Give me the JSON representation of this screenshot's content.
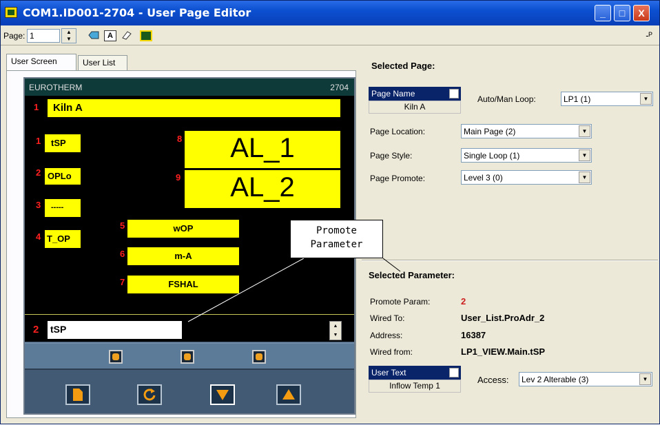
{
  "window": {
    "title": "COM1.ID001-2704 - User Page Editor",
    "min": "_",
    "max": "□",
    "close": "X"
  },
  "toolbar": {
    "page_label": "Page:",
    "page_value": "1",
    "pin": "-ᴾ"
  },
  "tabs": [
    {
      "label": "User Screen"
    },
    {
      "label": "User List"
    }
  ],
  "device": {
    "brand": "EUROTHERM",
    "model": "2704",
    "page_num": "1",
    "page_title": "Kiln A",
    "left_items": [
      {
        "num": "1",
        "label": "tSP"
      },
      {
        "num": "2",
        "label": "OPLo"
      },
      {
        "num": "3",
        "label": "-----"
      },
      {
        "num": "4",
        "label": "T_OP"
      }
    ],
    "big_items": [
      {
        "num": "8",
        "label": "AL_1"
      },
      {
        "num": "9",
        "label": "AL_2"
      }
    ],
    "mid_items": [
      {
        "num": "5",
        "label": "wOP"
      },
      {
        "num": "6",
        "label": "m-A"
      },
      {
        "num": "7",
        "label": "FSHAL"
      }
    ],
    "promote_num": "2",
    "promote_value": "tSP"
  },
  "callout": {
    "line1": "Promote",
    "line2": "Parameter"
  },
  "selected_page": {
    "title": "Selected Page:",
    "page_name_label": "Page Name",
    "page_name_value": "Kiln A",
    "auto_man_label": "Auto/Man Loop:",
    "auto_man_value": "LP1 (1)",
    "location_label": "Page Location:",
    "location_value": "Main Page (2)",
    "style_label": "Page Style:",
    "style_value": "Single Loop (1)",
    "promote_label": "Page Promote:",
    "promote_value": "Level 3 (0)"
  },
  "selected_parameter": {
    "title": "Selected Parameter:",
    "promote_param_label": "Promote Param:",
    "promote_param_value": "2",
    "wired_to_label": "Wired To:",
    "wired_to_value": "User_List.ProAdr_2",
    "address_label": "Address:",
    "address_value": "16387",
    "wired_from_label": "Wired from:",
    "wired_from_value": "LP1_VIEW.Main.tSP",
    "user_text_label": "User Text",
    "user_text_value": "Inflow Temp 1",
    "access_label": "Access:",
    "access_value": "Lev 2 Alterable (3)"
  },
  "colors": {
    "title_bar": "#0b4fd0",
    "device_yellow": "#ffff00",
    "number_red": "#ff2020",
    "led_orange": "#f0a020"
  }
}
